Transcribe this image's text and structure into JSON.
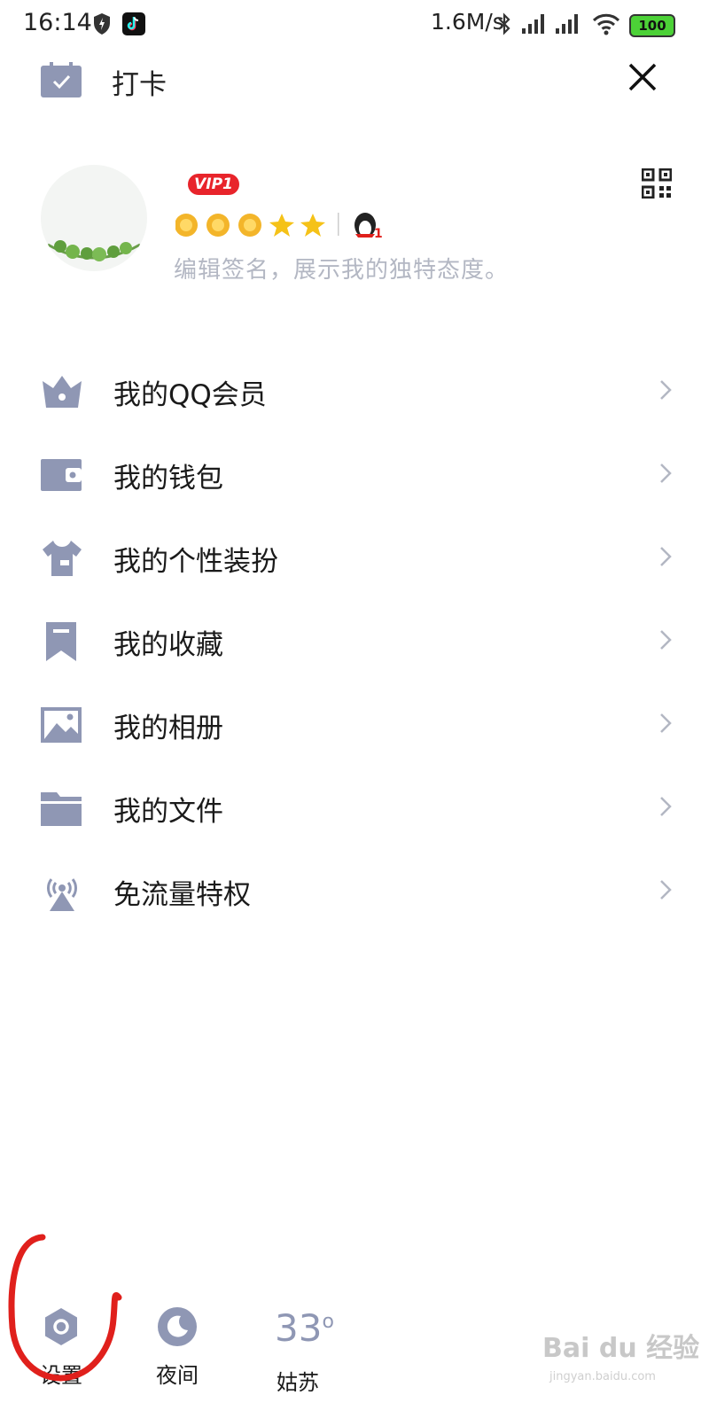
{
  "status_bar": {
    "time": "16:14",
    "network_speed": "1.6M/s",
    "battery": "100"
  },
  "header": {
    "checkin_label": "打卡"
  },
  "profile": {
    "vip_badge": "VIP1",
    "signature": "编辑签名，展示我的独特态度。",
    "level_badge": "1"
  },
  "menu": {
    "items": [
      {
        "label": "我的QQ会员",
        "icon": "crown-icon"
      },
      {
        "label": "我的钱包",
        "icon": "wallet-icon"
      },
      {
        "label": "我的个性装扮",
        "icon": "shirt-icon"
      },
      {
        "label": "我的收藏",
        "icon": "bookmark-icon"
      },
      {
        "label": "我的相册",
        "icon": "photo-icon"
      },
      {
        "label": "我的文件",
        "icon": "folder-icon"
      },
      {
        "label": "免流量特权",
        "icon": "broadcast-icon"
      }
    ]
  },
  "bottom_bar": {
    "settings_label": "设置",
    "night_label": "夜间",
    "weather_temp": "33",
    "weather_unit": "o",
    "weather_city": "姑苏"
  },
  "watermark": {
    "text": "Bai du 经验",
    "sub": "jingyan.baidu.com"
  },
  "colors": {
    "icon_gray": "#8f97b4",
    "vip_red": "#e8242b",
    "signature_gray": "#b3b7c3",
    "annotation_red": "#e0201c"
  }
}
